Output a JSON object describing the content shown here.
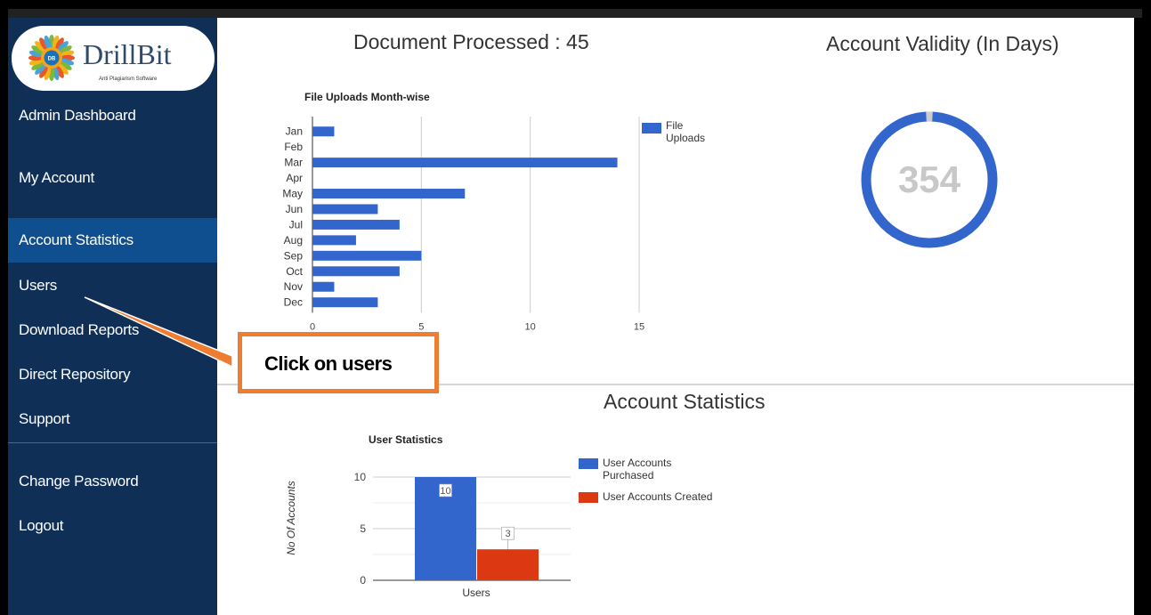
{
  "logo": {
    "brand": "DrillBit",
    "tagline": "Anti Plagiarism Software",
    "badge": "DB"
  },
  "sidebar": {
    "items": [
      {
        "label": "Admin Dashboard"
      },
      {
        "label": "My Account"
      },
      {
        "label": "Account Statistics"
      },
      {
        "label": "Users"
      },
      {
        "label": "Download Reports"
      },
      {
        "label": "Direct Repository"
      },
      {
        "label": "Support"
      },
      {
        "label": "Change Password"
      },
      {
        "label": "Logout"
      }
    ],
    "active_index": 2
  },
  "main": {
    "documents_processed": "Document Processed : 45",
    "account_validity_title": "Account Validity (In Days)",
    "account_validity_days": "354",
    "account_statistics_title": "Account Statistics"
  },
  "callout": {
    "text": "Click on users",
    "color": "#ed7d31"
  },
  "colors": {
    "bar_blue": "#3366cc",
    "bar_red": "#dc3912",
    "sidebar_bg": "#0f2f57",
    "sidebar_active": "#0f4f8f"
  },
  "chart_data": [
    {
      "type": "bar",
      "orientation": "horizontal",
      "title": "File Uploads Month-wise",
      "categories": [
        "Jan",
        "Feb",
        "Mar",
        "Apr",
        "May",
        "Jun",
        "Jul",
        "Aug",
        "Sep",
        "Oct",
        "Nov",
        "Dec"
      ],
      "series": [
        {
          "name": "File Uploads",
          "values": [
            1,
            0,
            14,
            0,
            7,
            3,
            4,
            2,
            5,
            4,
            1,
            3
          ]
        }
      ],
      "xticks": [
        0,
        5,
        10,
        15
      ],
      "xlim": [
        0,
        15
      ],
      "legend": "right"
    },
    {
      "type": "bar",
      "title": "User Statistics",
      "categories": [
        "Users"
      ],
      "series": [
        {
          "name": "User Accounts Purchased",
          "values": [
            10
          ]
        },
        {
          "name": "User Accounts Created",
          "values": [
            3
          ]
        }
      ],
      "ylabel": "No Of Accounts",
      "yticks": [
        0,
        5,
        10
      ],
      "ylim": [
        0,
        10
      ],
      "legend": "right"
    }
  ]
}
